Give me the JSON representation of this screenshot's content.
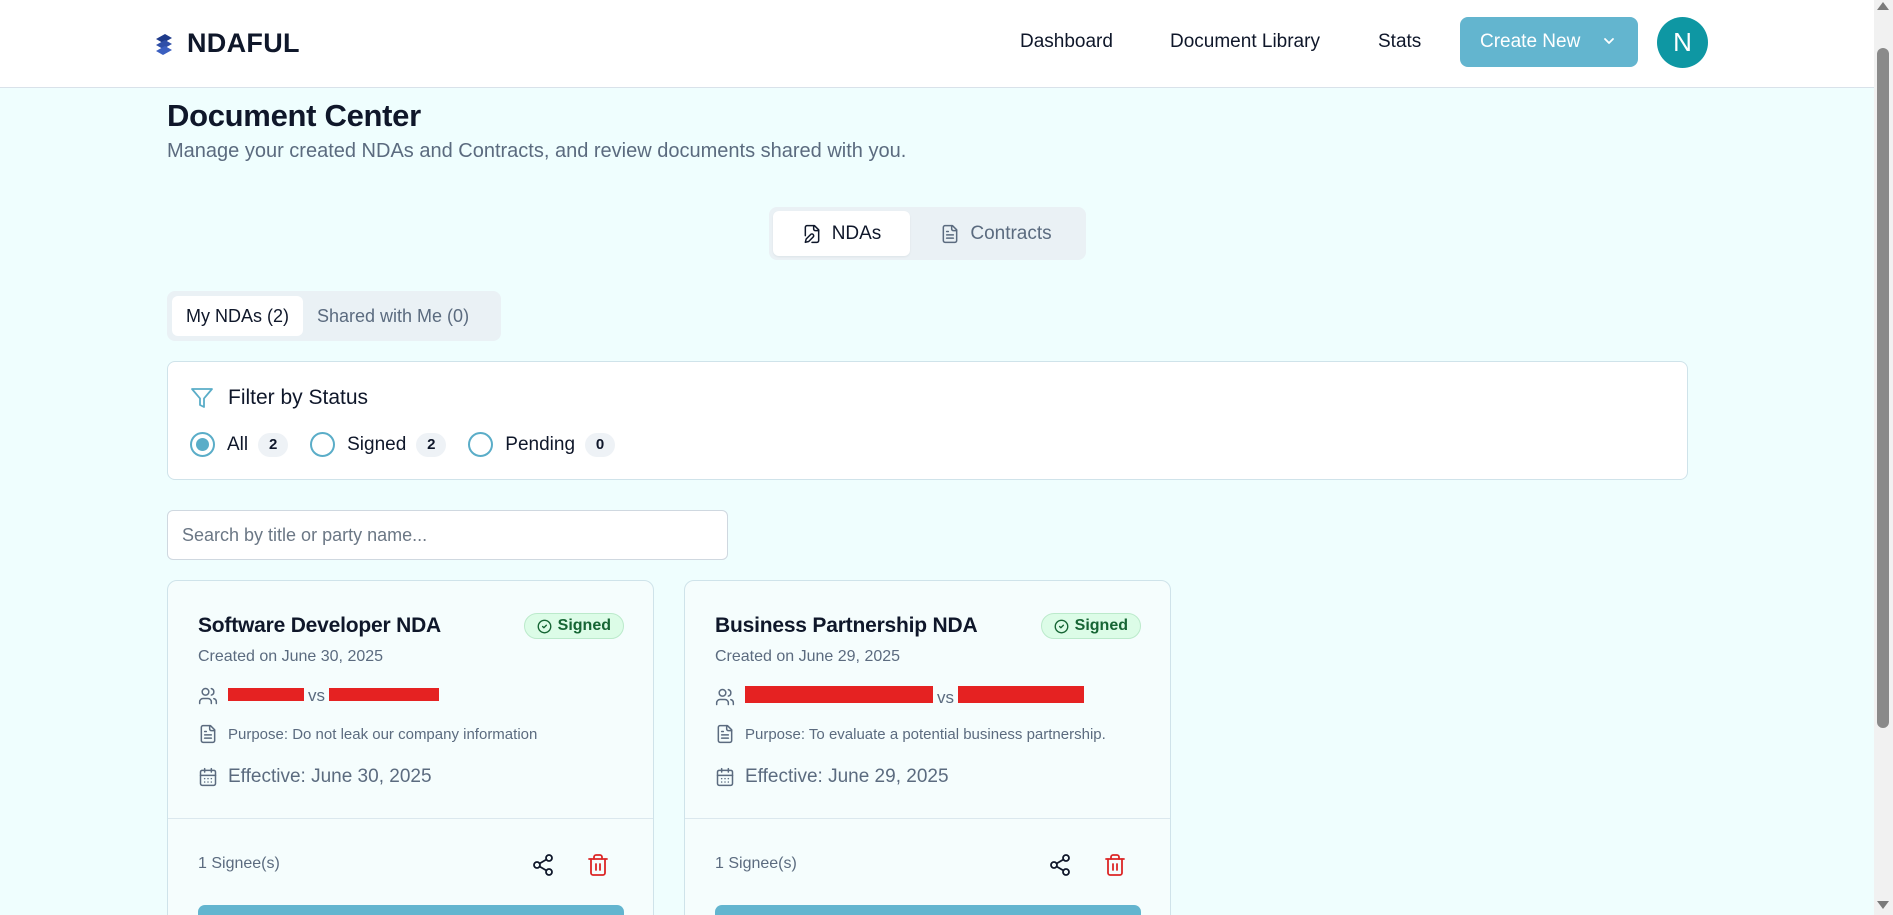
{
  "brand": {
    "name": "NDAFUL"
  },
  "nav": {
    "dashboard": "Dashboard",
    "library": "Document Library",
    "stats": "Stats",
    "create_new": "Create New"
  },
  "user": {
    "initial": "N"
  },
  "page": {
    "title": "Document Center",
    "subtitle": "Manage your created NDAs and Contracts, and review documents shared with you."
  },
  "main_tabs": [
    {
      "label": "NDAs",
      "active": true
    },
    {
      "label": "Contracts",
      "active": false
    }
  ],
  "sub_tabs": [
    {
      "label": "My NDAs (2)",
      "active": true
    },
    {
      "label": "Shared with Me (0)",
      "active": false
    }
  ],
  "filter": {
    "title": "Filter by Status",
    "options": [
      {
        "label": "All",
        "count": "2",
        "selected": true
      },
      {
        "label": "Signed",
        "count": "2",
        "selected": false
      },
      {
        "label": "Pending",
        "count": "0",
        "selected": false
      }
    ]
  },
  "search": {
    "placeholder": "Search by title or party name..."
  },
  "cards": [
    {
      "title": "Software Developer NDA",
      "status": "Signed",
      "created": "Created on June 30, 2025",
      "vs": "vs",
      "purpose": "Purpose: Do not leak our company information",
      "effective": "Effective: June 30, 2025",
      "signees": "1 Signee(s)"
    },
    {
      "title": "Business Partnership NDA",
      "status": "Signed",
      "created": "Created on June 29, 2025",
      "vs": "vs",
      "purpose": "Purpose: To evaluate a potential business partnership.",
      "effective": "Effective: June 29, 2025",
      "signees": "1 Signee(s)"
    }
  ],
  "colors": {
    "accent": "#63b5cf",
    "avatar": "#0e97a3",
    "background": "#effefe",
    "signed_bg": "#dcfce7",
    "signed_text": "#166534",
    "danger": "#dc2626",
    "redaction": "#e52222"
  },
  "icons": {
    "logo": "stacked-layers-icon",
    "create_chevron": "chevron-down-icon",
    "nda_tab": "file-pen-icon",
    "contract_tab": "file-text-icon",
    "filter": "filter-icon",
    "status": "check-circle-icon",
    "parties": "users-icon",
    "purpose": "file-text-icon",
    "effective": "calendar-icon",
    "share": "share-icon",
    "delete": "trash-icon"
  }
}
